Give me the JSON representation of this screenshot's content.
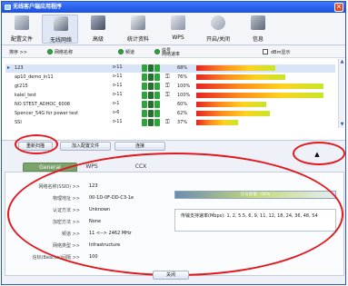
{
  "window": {
    "title": "无线客户端应用程序",
    "close_glyph": "✕"
  },
  "toolbar": {
    "items": [
      {
        "label": "配置文件",
        "icon": "profile-icon"
      },
      {
        "label": "无线网络",
        "icon": "network-icon",
        "active": true
      },
      {
        "label": "高级",
        "icon": "advanced-icon"
      },
      {
        "label": "统计资料",
        "icon": "statistics-icon"
      },
      {
        "label": "WPS",
        "icon": "wps-icon"
      },
      {
        "label": "开启/关闭",
        "icon": "radio-onoff-icon"
      },
      {
        "label": "信息",
        "icon": "about-icon"
      }
    ]
  },
  "list_header": {
    "sort": "排序 >>",
    "col_name": "网络名称",
    "col_channel": "频道",
    "col_signal": "信号\n网络速率",
    "dbm": "dBm显示"
  },
  "networks": [
    {
      "ssid": "123",
      "channel": "11",
      "pct": "68%",
      "bar": 0.62,
      "selected": true
    },
    {
      "ssid": "ap10_demo_in11",
      "channel": "11",
      "pct": "76%",
      "bar": 0.7
    },
    {
      "ssid": "gt215",
      "channel": "11",
      "pct": "100%",
      "bar": 1.0
    },
    {
      "ssid": "kalel_test",
      "channel": "11",
      "pct": "100%",
      "bar": 1.0
    },
    {
      "ssid": "NO STEST_ADHOC_6008",
      "channel": "1",
      "pct": "60%",
      "bar": 0.55
    },
    {
      "ssid": "Spencer_54G for power test",
      "channel": "6",
      "pct": "62%",
      "bar": 0.58
    },
    {
      "ssid": "SSI",
      "channel": "11",
      "pct": "37%",
      "bar": 0.33
    }
  ],
  "buttons": {
    "rescan": "重新扫描",
    "add_profile": "加入配置文件",
    "connect": "连接",
    "expand": "▲",
    "close": "关闭"
  },
  "tabs": [
    "General",
    "WPS",
    "CCX"
  ],
  "details": {
    "fields": [
      {
        "k": "网络名称(SSID) >>",
        "v": "123"
      },
      {
        "k": "物理地址 >>",
        "v": "00-1D-0F-DD-C3-1e"
      },
      {
        "k": "认证方法 >>",
        "v": "Unknown"
      },
      {
        "k": "加密方法 >>",
        "v": "None"
      },
      {
        "k": "频道 >>",
        "v": "11 <--> 2462 MHz"
      },
      {
        "k": "网络类型 >>",
        "v": "Infrastructure"
      },
      {
        "k": "信标(Beacon)间隔 >>",
        "v": "100"
      }
    ],
    "quality_label": "信号质量 : 68%",
    "rates": "传输支持速率(Mbps): 1, 2, 5.5, 6, 9, 11, 12, 18, 24, 36, 48, 54"
  }
}
